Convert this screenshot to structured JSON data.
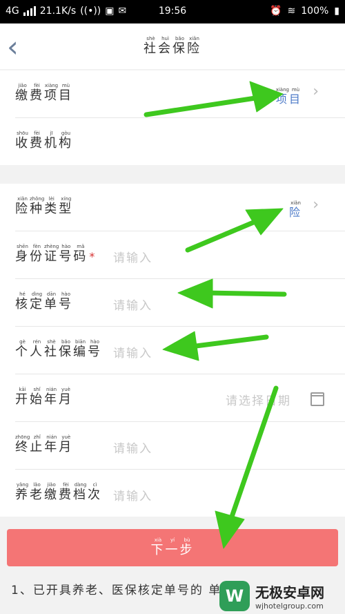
{
  "status": {
    "network": "4G",
    "speed": "21.1K/s",
    "time": "19:56",
    "battery": "100%"
  },
  "nav": {
    "title": "社会保险",
    "title_ruby": [
      "shè",
      "huì",
      "bǎo",
      "xiǎn"
    ]
  },
  "section1": [
    {
      "label": "缴费项目",
      "ruby": [
        "jiǎo",
        "fèi",
        "xiàng",
        "mù"
      ],
      "value": "项目",
      "value_ruby": [
        "xiàng",
        "mù"
      ],
      "chevron": true
    },
    {
      "label": "收费机构",
      "ruby": [
        "shōu",
        "fèi",
        "jī",
        "gòu"
      ],
      "value": "",
      "chevron": false
    }
  ],
  "section2": [
    {
      "label": "险种类型",
      "ruby": [
        "xiǎn",
        "zhǒng",
        "lèi",
        "xíng"
      ],
      "value": "险",
      "value_ruby": [
        "xiǎn"
      ],
      "chevron": true
    },
    {
      "label": "身份证号码",
      "ruby": [
        "shēn",
        "fèn",
        "zhèng",
        "hào",
        "mǎ"
      ],
      "placeholder": "请输入",
      "required": true
    },
    {
      "label": "核定单号",
      "ruby": [
        "hé",
        "dìng",
        "dān",
        "hào"
      ],
      "placeholder": "请输入"
    },
    {
      "label": "个人社保编号",
      "ruby": [
        "gè",
        "rén",
        "shè",
        "bǎo",
        "biān",
        "hào"
      ],
      "placeholder": "请输入"
    },
    {
      "label": "开始年月",
      "ruby": [
        "kāi",
        "shǐ",
        "nián",
        "yuè"
      ],
      "placeholder_right": "请选择日期",
      "calendar": true
    },
    {
      "label": "终止年月",
      "ruby": [
        "zhōng",
        "zhǐ",
        "nián",
        "yuè"
      ],
      "placeholder": "请输入"
    },
    {
      "label": "养老缴费档次",
      "ruby": [
        "yǎng",
        "lǎo",
        "jiǎo",
        "fèi",
        "dàng",
        "cì"
      ],
      "placeholder": "请输入"
    }
  ],
  "next_button": {
    "label": "下一步",
    "ruby": [
      "xià",
      "yí",
      "bù"
    ]
  },
  "note": "1、已开具养老、医保核定单号的 单号:",
  "watermark": {
    "name": "无极安卓网",
    "url": "wjhotelgroup.com"
  },
  "colors": {
    "accent_arrow": "#3ec81e",
    "button": "#f47575",
    "link": "#4a78c7"
  }
}
